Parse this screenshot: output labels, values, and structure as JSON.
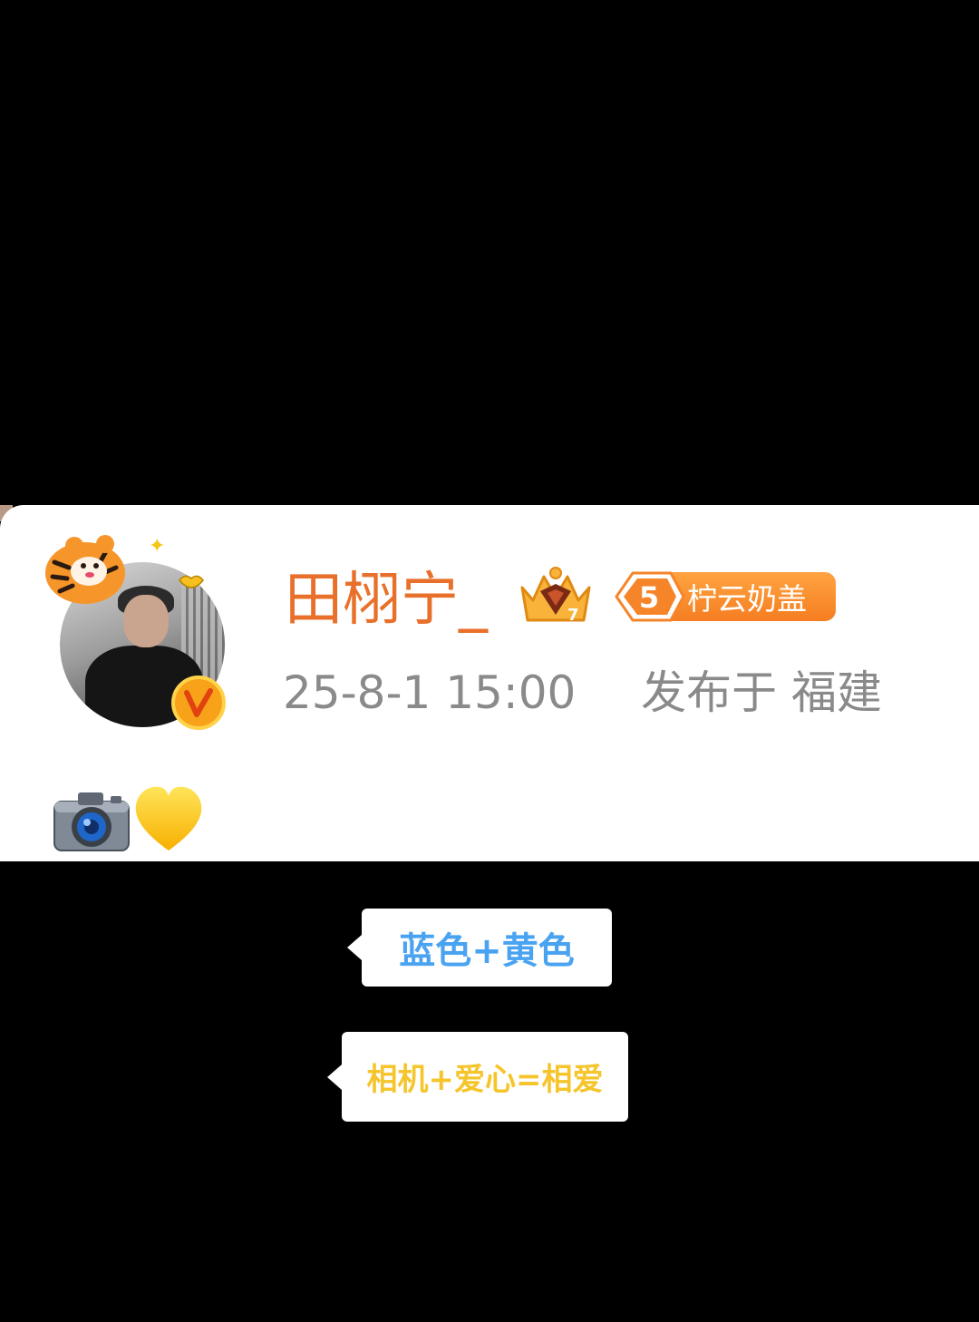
{
  "post": {
    "username": "田栩宁_",
    "crown_level": "7",
    "fan_badge": {
      "level": "5",
      "label": "柠云奶盖"
    },
    "timestamp": "25-8-1 15:00",
    "location_text": "发布于 福建",
    "content_emojis": [
      "camera-icon",
      "yellow-heart-icon"
    ]
  },
  "annotations": [
    {
      "text": "蓝色+黄色",
      "color": "#4aa3f0"
    },
    {
      "text": "相机+爱心=相爱",
      "color": "#f5c52b"
    }
  ],
  "colors": {
    "username": "#e8702a",
    "badge": "#f57e21",
    "meta_text": "#8a8a8a",
    "verify_badge": "#f8a21a"
  }
}
